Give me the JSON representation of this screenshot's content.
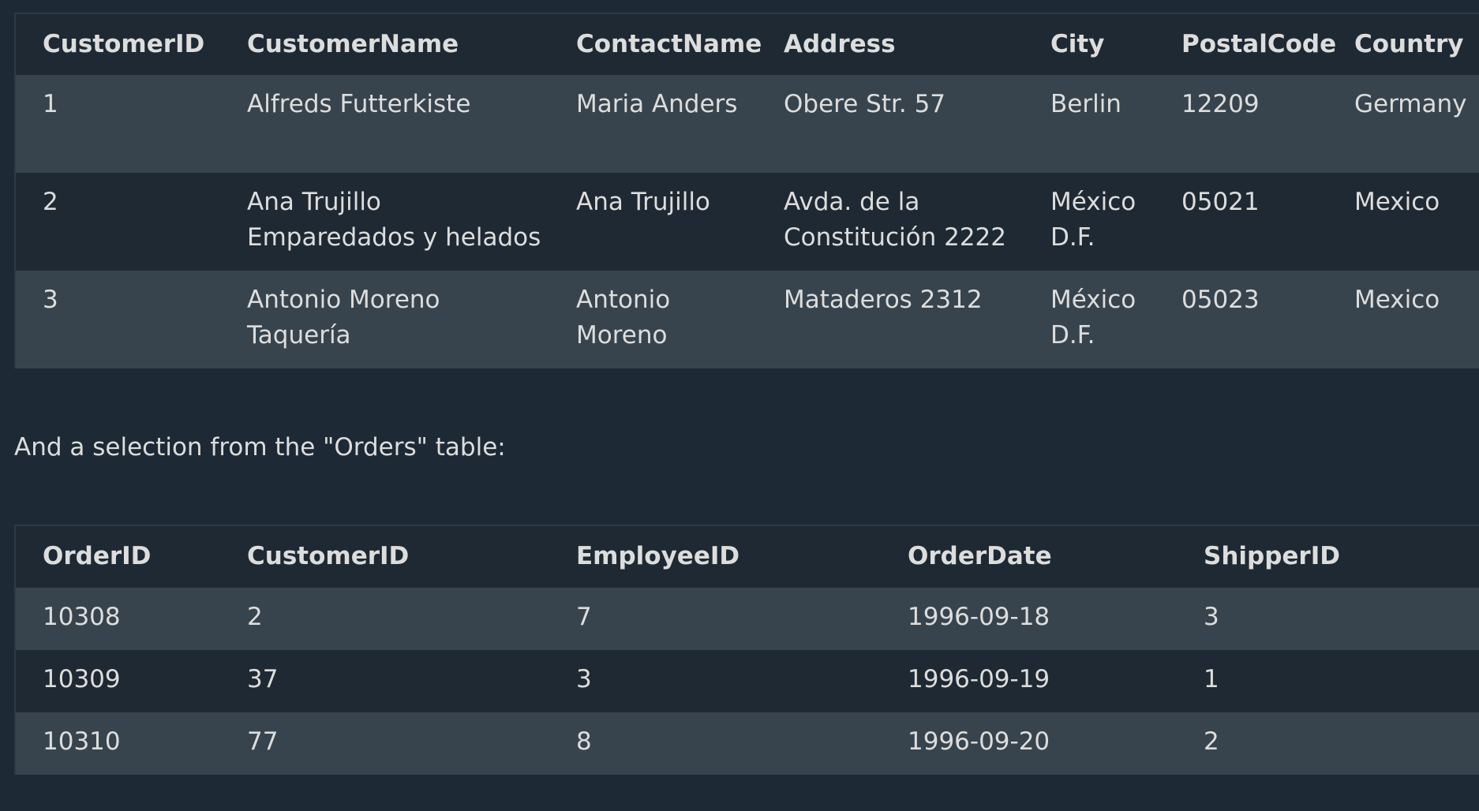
{
  "customers": {
    "headers": [
      "CustomerID",
      "CustomerName",
      "ContactName",
      "Address",
      "City",
      "PostalCode",
      "Country"
    ],
    "rows": [
      [
        "1",
        "Alfreds Futterkiste",
        "Maria Anders",
        "Obere Str. 57",
        "Berlin",
        "12209",
        "Germany"
      ],
      [
        "2",
        "Ana Trujillo Emparedados y helados",
        "Ana Trujillo",
        "Avda. de la Constitución 2222",
        "México D.F.",
        "05021",
        "Mexico"
      ],
      [
        "3",
        "Antonio Moreno Taquería",
        "Antonio Moreno",
        "Mataderos 2312",
        "México D.F.",
        "05023",
        "Mexico"
      ]
    ]
  },
  "caption": "And a selection from the \"Orders\" table:",
  "orders": {
    "headers": [
      "OrderID",
      "CustomerID",
      "EmployeeID",
      "OrderDate",
      "ShipperID"
    ],
    "rows": [
      [
        "10308",
        "2",
        "7",
        "1996-09-18",
        "3"
      ],
      [
        "10309",
        "37",
        "3",
        "1996-09-19",
        "1"
      ],
      [
        "10310",
        "77",
        "8",
        "1996-09-20",
        "2"
      ]
    ]
  },
  "colors": {
    "background": "#1d2a35",
    "row_light": "#38444d",
    "row_dark": "#1f2933",
    "text": "#dddddd"
  }
}
